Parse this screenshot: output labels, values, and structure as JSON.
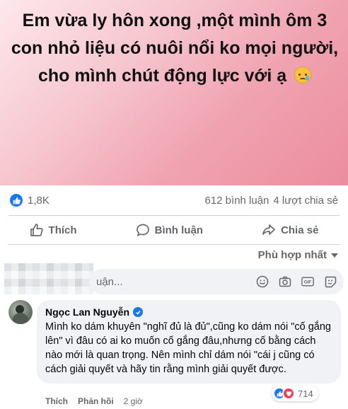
{
  "post": {
    "text": "Em vừa ly hôn xong ,một mình ôm 3 con nhỏ liệu có nuôi nổi ko mọi người, cho mình chút động lực với ạ",
    "emoji_icon": "crying-face-icon"
  },
  "stats": {
    "reactions_count": "1,8K",
    "comments": "612 bình luận",
    "shares": "4 lượt chia sẻ"
  },
  "actions": {
    "like": "Thích",
    "comment": "Bình luận",
    "share": "Chia sẻ"
  },
  "sort_label": "Phù hợp nhất",
  "comment_input": {
    "placeholder_visible": "uận..."
  },
  "comment": {
    "author": "Ngọc Lan Nguyễn",
    "text": "Mình ko dám khuyên \"nghĩ đủ là đủ\",cũng ko dám nói \"cố gắng lên\" vì đâu có ai ko muốn cố gắng đâu,nhưng cố bằng cách nào mới là quan trọng. Nên mình chỉ dám nói \"cái j cũng có cách giải quyết và hãy tin rằng mình giải quyết được.",
    "reaction_count": "714",
    "like_link": "Thích",
    "reply_link": "Phản hồi",
    "time": "2 giờ"
  },
  "colors": {
    "accent": "#1877f2",
    "love": "#f33e58",
    "muted_text": "#65676b"
  }
}
